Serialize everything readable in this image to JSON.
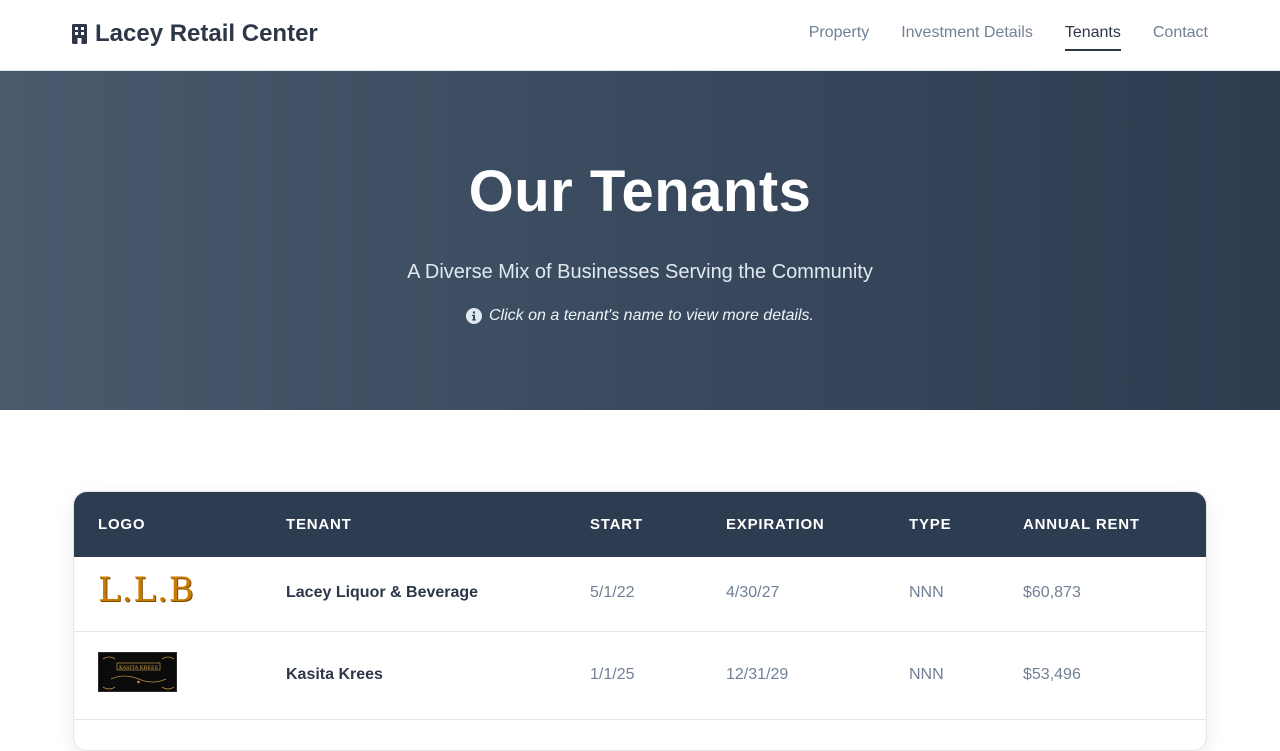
{
  "nav": {
    "brand": "Lacey Retail Center",
    "brand_icon": "building-icon",
    "links": [
      {
        "label": "Property",
        "active": false
      },
      {
        "label": "Investment Details",
        "active": false
      },
      {
        "label": "Tenants",
        "active": true
      },
      {
        "label": "Contact",
        "active": false
      }
    ]
  },
  "hero": {
    "title": "Our Tenants",
    "subtitle": "A Diverse Mix of Businesses Serving the Community",
    "hint": "Click on a tenant's name to view more details.",
    "hint_icon": "info-circle-icon"
  },
  "table": {
    "headers": [
      "LOGO",
      "TENANT",
      "START",
      "EXPIRATION",
      "TYPE",
      "ANNUAL RENT"
    ],
    "rows": [
      {
        "logo": "L.L.B",
        "tenant": "Lacey Liquor & Beverage",
        "start": "5/1/22",
        "expiration": "4/30/27",
        "type": "NNN",
        "rent": "$60,873"
      },
      {
        "logo": "KASITA KREES",
        "tenant": "Kasita Krees",
        "start": "1/1/25",
        "expiration": "12/31/29",
        "type": "NNN",
        "rent": "$53,496"
      }
    ]
  },
  "colors": {
    "header_bg": "#2d3c50",
    "hero_start": "#4a5a6d",
    "hero_end": "#2e3c50",
    "text_dark": "#2d3748",
    "text_muted": "#718096",
    "llb_gold": "#c77b00"
  }
}
